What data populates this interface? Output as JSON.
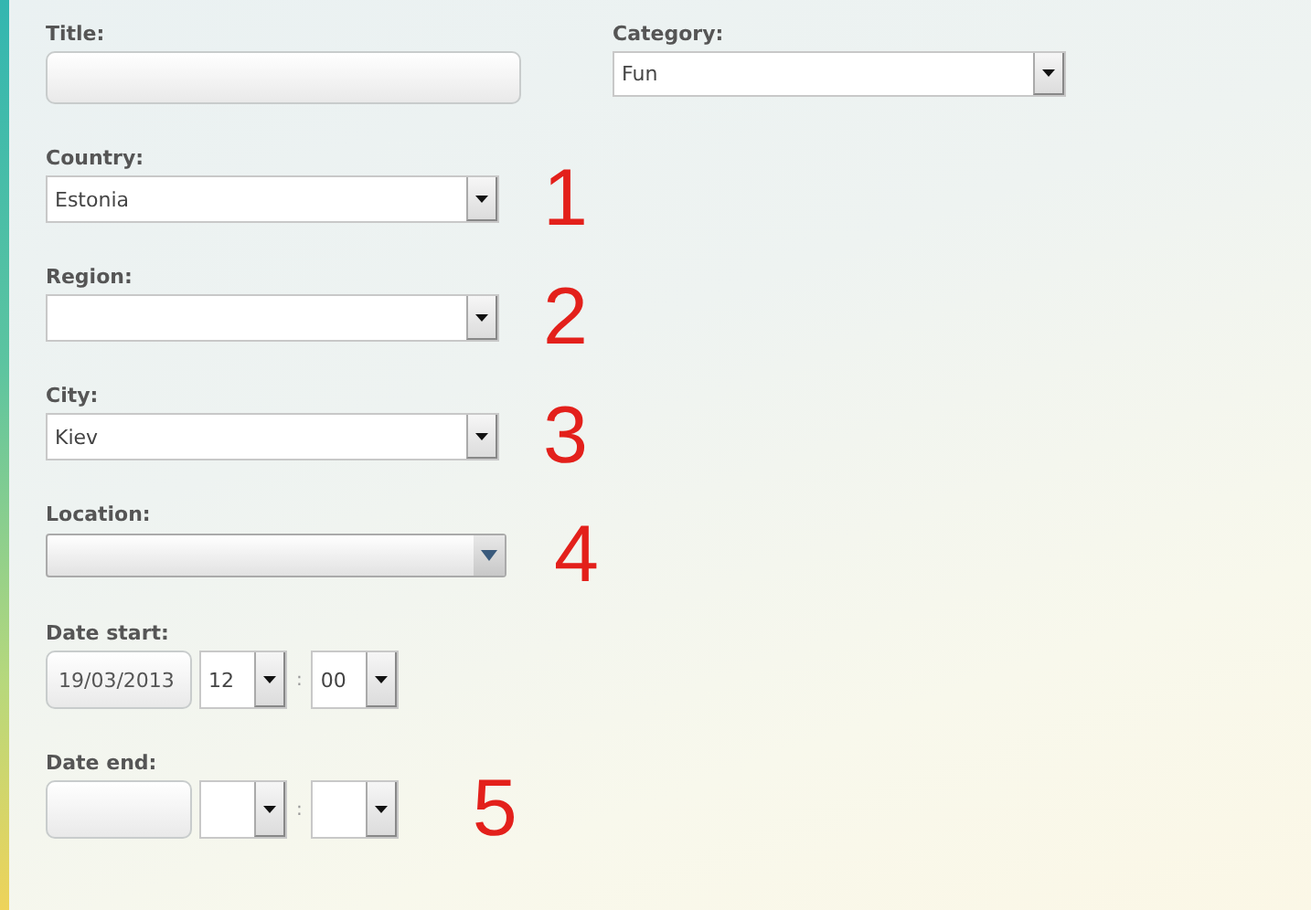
{
  "title_field": {
    "label": "Title:"
  },
  "category": {
    "label": "Category:",
    "value": "Fun"
  },
  "fields": [
    {
      "kind": "select",
      "label": "Country:",
      "value": "Estonia",
      "annotation": "1"
    },
    {
      "kind": "select",
      "label": "Region:",
      "annotation": "2"
    },
    {
      "kind": "select",
      "label": "City:",
      "value": "Kiev",
      "annotation": "3"
    },
    {
      "kind": "combo",
      "label": "Location:",
      "annotation": "4"
    }
  ],
  "date_start": {
    "label": "Date start:",
    "date": "19/03/2013",
    "hour": "12",
    "separator": ":",
    "minute": "00"
  },
  "date_end": {
    "label": "Date end:",
    "separator": ":",
    "annotation": "5"
  }
}
